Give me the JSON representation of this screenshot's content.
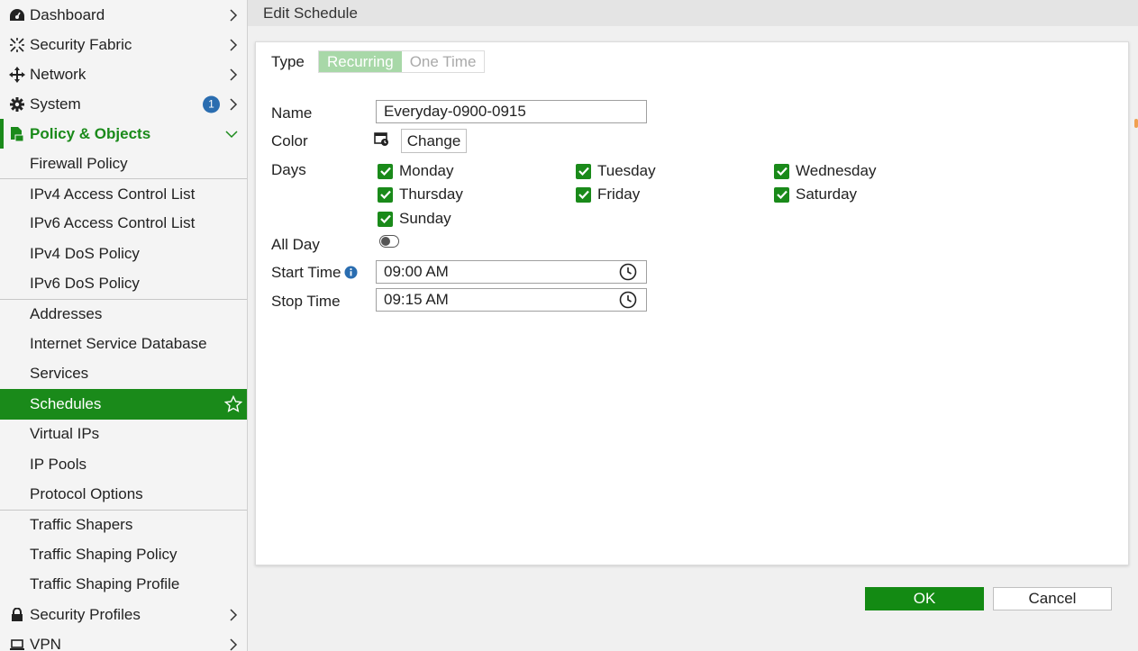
{
  "sidebar": {
    "top_items": [
      {
        "label": "Dashboard",
        "icon": "dashboard-icon"
      },
      {
        "label": "Security Fabric",
        "icon": "security-fabric-icon"
      },
      {
        "label": "Network",
        "icon": "network-icon"
      },
      {
        "label": "System",
        "icon": "gear-icon",
        "badge": "1"
      },
      {
        "label": "Policy & Objects",
        "icon": "policy-icon"
      }
    ],
    "sub_items": [
      "Firewall Policy",
      "IPv4 Access Control List",
      "IPv6 Access Control List",
      "IPv4 DoS Policy",
      "IPv6 DoS Policy",
      "Addresses",
      "Internet Service Database",
      "Services",
      "Schedules",
      "Virtual IPs",
      "IP Pools",
      "Protocol Options",
      "Traffic Shapers",
      "Traffic Shaping Policy",
      "Traffic Shaping Profile"
    ],
    "bottom_items": [
      {
        "label": "Security Profiles",
        "icon": "lock-icon"
      },
      {
        "label": "VPN",
        "icon": "laptop-icon"
      }
    ]
  },
  "header": {
    "title": "Edit Schedule"
  },
  "form": {
    "type_label": "Type",
    "type_options": [
      "Recurring",
      "One Time"
    ],
    "type_selected": "Recurring",
    "name_label": "Name",
    "name_value": "Everyday-0900-0915",
    "color_label": "Color",
    "change_label": "Change",
    "days_label": "Days",
    "days": [
      {
        "label": "Monday",
        "checked": true
      },
      {
        "label": "Tuesday",
        "checked": true
      },
      {
        "label": "Wednesday",
        "checked": true
      },
      {
        "label": "Thursday",
        "checked": true
      },
      {
        "label": "Friday",
        "checked": true
      },
      {
        "label": "Saturday",
        "checked": true
      },
      {
        "label": "Sunday",
        "checked": true
      }
    ],
    "all_day_label": "All Day",
    "all_day_on": false,
    "start_time_label": "Start Time",
    "start_time_value": "09:00 AM",
    "stop_time_label": "Stop Time",
    "stop_time_value": "09:15 AM"
  },
  "footer": {
    "ok_label": "OK",
    "cancel_label": "Cancel"
  },
  "colors": {
    "accent": "#1a8a1a",
    "selected_bg": "#1a8a1a",
    "badge": "#2a6db0"
  }
}
